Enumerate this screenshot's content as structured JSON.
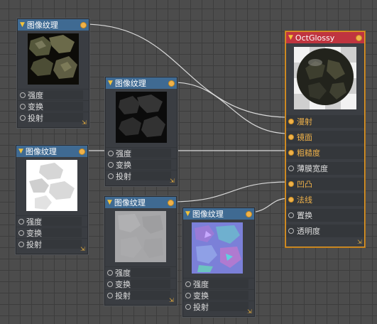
{
  "texture_nodes": [
    {
      "title": "图像纹理",
      "inputs": [
        "强度",
        "变换",
        "投射"
      ]
    },
    {
      "title": "图像纹理",
      "inputs": [
        "强度",
        "变换",
        "投射"
      ]
    },
    {
      "title": "图像纹理",
      "inputs": [
        "强度",
        "变换",
        "投射"
      ]
    },
    {
      "title": "图像纹理",
      "inputs": [
        "强度",
        "变换",
        "投射"
      ]
    },
    {
      "title": "图像纹理",
      "inputs": [
        "强度",
        "变换",
        "投射"
      ]
    }
  ],
  "material_node": {
    "title": "OctGlossy",
    "inputs": [
      "漫射",
      "镜面",
      "粗糙度",
      "薄膜宽度",
      "凹凸",
      "法线",
      "置换",
      "透明度"
    ]
  },
  "colors": {
    "wire": "#d9d9d9",
    "port": "#f0b24a",
    "header_blue": "#3f6a92",
    "header_red": "#c0343f",
    "selected_outline": "#e09a2a"
  },
  "icons": {
    "collapse": "triangle-down-icon",
    "resize": "resize-grip-icon"
  }
}
